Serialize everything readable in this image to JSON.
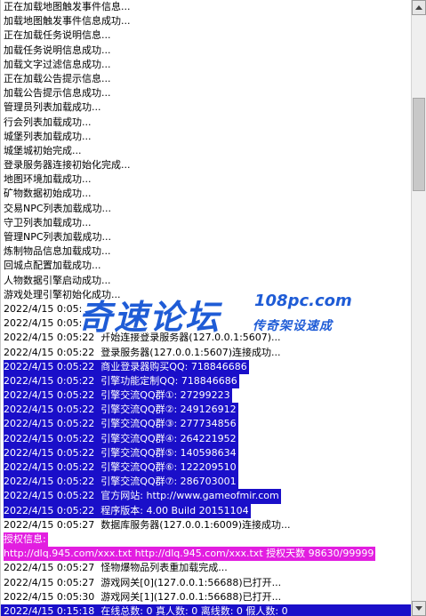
{
  "log_lines": [
    {
      "text": "正在加载地图触发事件信息...",
      "style": "none"
    },
    {
      "text": "加载地图触发事件信息成功...",
      "style": "none"
    },
    {
      "text": "正在加载任务说明信息...",
      "style": "none"
    },
    {
      "text": "加载任务说明信息成功...",
      "style": "none"
    },
    {
      "text": "加载文字过滤信息成功...",
      "style": "none"
    },
    {
      "text": "正在加载公告提示信息...",
      "style": "none"
    },
    {
      "text": "加载公告提示信息成功...",
      "style": "none"
    },
    {
      "text": "管理员列表加载成功...",
      "style": "none"
    },
    {
      "text": "行会列表加载成功...",
      "style": "none"
    },
    {
      "text": "城堡列表加载成功...",
      "style": "none"
    },
    {
      "text": "城堡城初始完成...",
      "style": "none"
    },
    {
      "text": "登录服务器连接初始化完成...",
      "style": "none"
    },
    {
      "text": "地图环境加载成功...",
      "style": "none"
    },
    {
      "text": "矿物数据初始成功...",
      "style": "none"
    },
    {
      "text": "交易NPC列表加载成功...",
      "style": "none"
    },
    {
      "text": "守卫列表加载成功...",
      "style": "none"
    },
    {
      "text": "管理NPC列表加载成功...",
      "style": "none"
    },
    {
      "text": "炼制物品信息加载成功...",
      "style": "none"
    },
    {
      "text": "回城点配置加载成功...",
      "style": "none"
    },
    {
      "text": "人物数据引擎启动成功...",
      "style": "none"
    },
    {
      "text": "游戏处理引擎初始化成功...",
      "style": "none"
    },
    {
      "text": "2022/4/15 0:05:",
      "style": "none"
    },
    {
      "text": "2022/4/15 0:05:",
      "style": "none"
    },
    {
      "text": "2022/4/15 0:05:22  开始连接登录服务器(127.0.0.1:5607)...",
      "style": "none"
    },
    {
      "text": "2022/4/15 0:05:22  登录服务器(127.0.0.1:5607)连接成功...",
      "style": "none"
    },
    {
      "text": "2022/4/15 0:05:22  商业登录器购买QQ: 718846686",
      "style": "blue"
    },
    {
      "text": "2022/4/15 0:05:22  引擎功能定制QQ: 718846686",
      "style": "blue"
    },
    {
      "text": "2022/4/15 0:05:22  引擎交流QQ群①: 27299223",
      "style": "blue"
    },
    {
      "text": "2022/4/15 0:05:22  引擎交流QQ群②: 249126912",
      "style": "blue"
    },
    {
      "text": "2022/4/15 0:05:22  引擎交流QQ群③: 277734856",
      "style": "blue"
    },
    {
      "text": "2022/4/15 0:05:22  引擎交流QQ群④: 264221952",
      "style": "blue"
    },
    {
      "text": "2022/4/15 0:05:22  引擎交流QQ群⑤: 140598634",
      "style": "blue"
    },
    {
      "text": "2022/4/15 0:05:22  引擎交流QQ群⑥: 122209510",
      "style": "blue"
    },
    {
      "text": "2022/4/15 0:05:22  引擎交流QQ群⑦: 286703001",
      "style": "blue"
    },
    {
      "text": "2022/4/15 0:05:22  官方网站: http://www.gameofmir.com",
      "style": "blue"
    },
    {
      "text": "2022/4/15 0:05:22  程序版本: 4.00 Build 20151104",
      "style": "blue"
    },
    {
      "text": "2022/4/15 0:05:27  数据库服务器(127.0.0.1:6009)连接成功...",
      "style": "none"
    },
    {
      "text": "授权信息:",
      "style": "magenta"
    },
    {
      "text": "http://dlq.945.com/xxx.txt http://dlq.945.com/xxx.txt 授权天数 98630/99999",
      "style": "magenta"
    },
    {
      "text": "2022/4/15 0:05:27  怪物爆物品列表重加载完成...",
      "style": "none"
    },
    {
      "text": "2022/4/15 0:05:27  游戏网关[0](127.0.0.1:56688)已打开...",
      "style": "none"
    },
    {
      "text": "2022/4/15 0:05:30  游戏网关[1](127.0.0.1:56688)已打开...",
      "style": "none"
    },
    {
      "text": "2022/4/15 0:15:18  在线总数: 0 真人数: 0 离线数: 0 假人数: 0",
      "style": "blue-full"
    }
  ],
  "watermark": {
    "main": "奇速论坛",
    "domain": "108pc.com",
    "sub": "传奇架设速成"
  },
  "colors": {
    "highlight_blue": "#1a0fc9",
    "highlight_magenta": "#e21ee0",
    "watermark_blue": "#1f5cd6"
  }
}
